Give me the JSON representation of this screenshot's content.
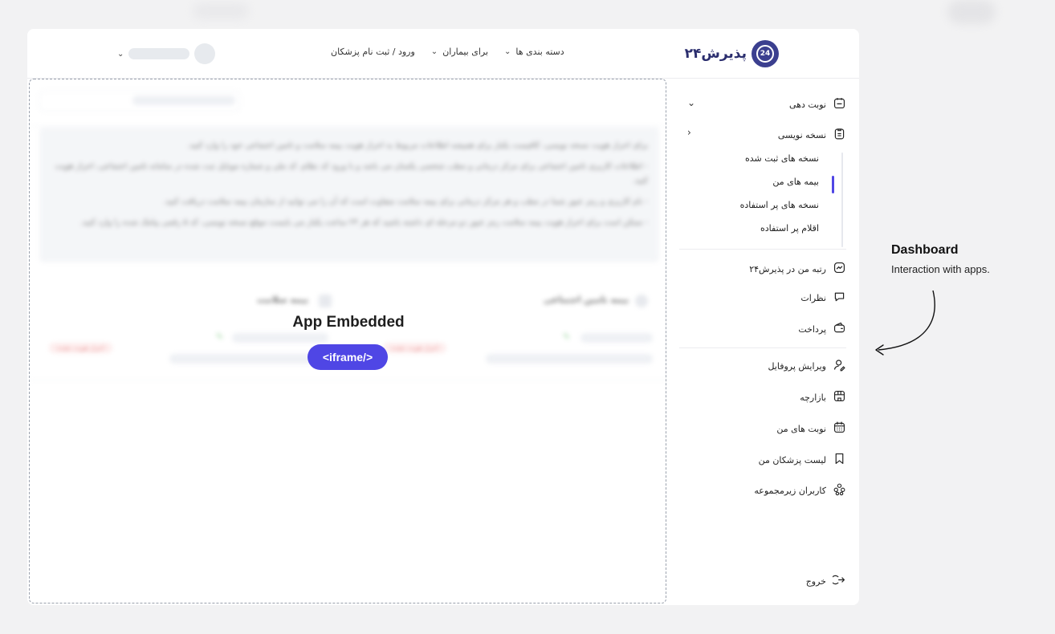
{
  "header": {
    "logo_text": "پذیرش۲۴",
    "logo_badge": "24",
    "nav": [
      {
        "label": "دسته بندی ها"
      },
      {
        "label": "برای بیماران"
      },
      {
        "label": "ورود / ثبت نام پزشکان"
      }
    ]
  },
  "embed": {
    "title": "App Embedded",
    "button_label": "<iframe/>",
    "notice_lines": [
      "برای احراز هویت نسخه نویسی، کافیست یکبار برای همیشه اطلاعات مربوط به احراز هویت بیمه سلامت و تامین اجتماعی خود را وارد کنید.",
      "- اطلاعات کاربری تامین اجتماعی برای مرکز درمانی و مطب شخصی یکسان می باشد و با ورود کد نظام، کد ملی و شماره موبایل ثبت شده در سامانه تامین اجتماعی، احراز هویت کنید.",
      "- نام کاربری و رمز عبور شما در مطب و هر مرکز درمانی برای بیمه سلامت متفاوت است که آن را می توانید از سازمان بیمه سلامت دریافت کنید.",
      "- ممکن است برای احراز هویت بیمه سلامت رمز عبور دو مرحله ای داشته باشید که هر ۲۴ ساعت یکبار می بایست موقع نسخه نویسی، کد ۵ رقمی پیامک شده را وارد کنید."
    ],
    "insurance_left": "بیمه سلامت",
    "insurance_right": "بیمه تامین اجتماعی",
    "status_badge": "احراز هویت نشده"
  },
  "sidebar": {
    "items": [
      {
        "label": "نوبت دهی",
        "icon": "calendar-icon",
        "arrow": "⌄"
      },
      {
        "label": "نسخه نویسی",
        "icon": "clipboard-icon",
        "arrow": "‹"
      },
      {
        "label": "رتبه من در پذیرش۲۴",
        "icon": "chart-icon"
      },
      {
        "label": "نظرات",
        "icon": "comment-icon"
      },
      {
        "label": "پرداخت",
        "icon": "wallet-icon"
      },
      {
        "label": "ویرایش پروفایل",
        "icon": "user-edit-icon"
      },
      {
        "label": "بازارچه",
        "icon": "shop-icon"
      },
      {
        "label": "نوبت های من",
        "icon": "calendar-grid-icon"
      },
      {
        "label": "لیست پزشکان من",
        "icon": "bookmark-icon"
      },
      {
        "label": "کاربران زیرمجموعه",
        "icon": "users-icon"
      }
    ],
    "sub_items": [
      {
        "label": "نسخه های ثبت شده"
      },
      {
        "label": "بیمه های من"
      },
      {
        "label": "نسخه های پر استفاده"
      },
      {
        "label": "اقلام پر استفاده"
      }
    ],
    "logout": "خروج"
  },
  "annotation": {
    "title": "Dashboard",
    "subtitle": "Interaction with apps."
  }
}
